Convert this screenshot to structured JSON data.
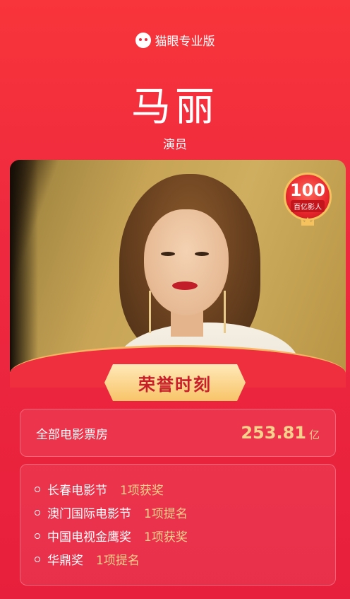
{
  "brand": {
    "name": "猫眼专业版",
    "icon": "cat-eye-icon"
  },
  "person": {
    "name": "马丽",
    "role": "演员"
  },
  "badge": {
    "number": "100",
    "label": "百亿影人"
  },
  "honor": {
    "title": "荣誉时刻"
  },
  "box_office": {
    "label": "全部电影票房",
    "value": "253.81",
    "unit": "亿"
  },
  "awards": [
    {
      "name": "长春电影节",
      "result": "1项获奖"
    },
    {
      "name": "澳门国际电影节",
      "result": "1项提名"
    },
    {
      "name": "中国电视金鹰奖",
      "result": "1项获奖"
    },
    {
      "name": "华鼎奖",
      "result": "1项提名"
    }
  ],
  "colors": {
    "background": "#ef2a3f",
    "accent_gold": "#f7d28c",
    "plate": "#f8c469"
  }
}
